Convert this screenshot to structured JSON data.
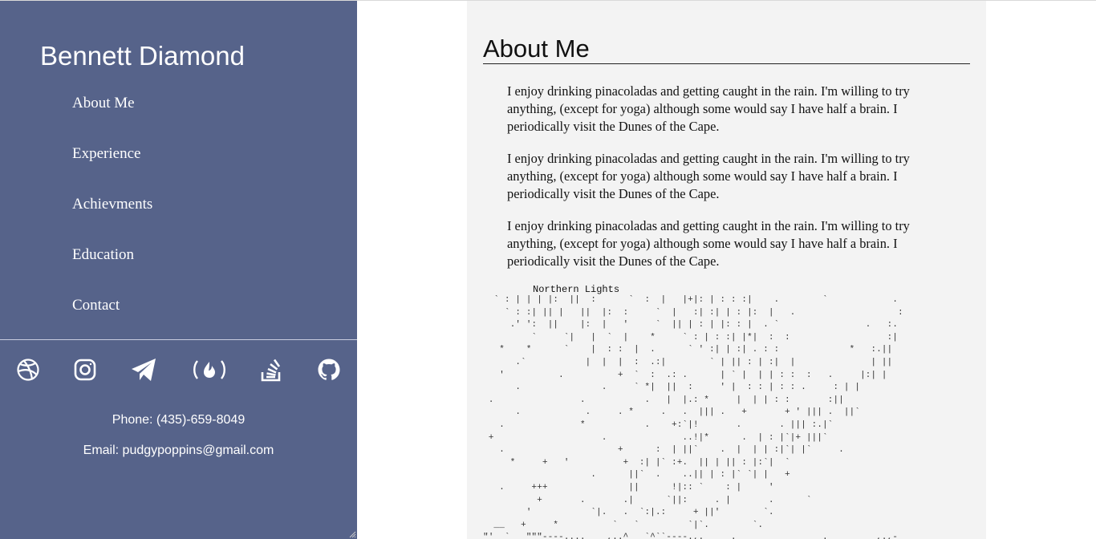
{
  "sidebar": {
    "name": "Bennett Diamond",
    "nav": [
      "About Me",
      "Experience",
      "Achievments",
      "Education",
      "Contact"
    ],
    "social_icons": [
      "dribbble-icon",
      "instagram-icon",
      "telegram-icon",
      "freecodecamp-icon",
      "stackoverflow-icon",
      "github-icon"
    ],
    "phone": "Phone: (435)-659-8049",
    "email": "Email: pudgypoppins@gmail.com"
  },
  "main": {
    "title": "About Me",
    "paragraphs": [
      "I enjoy drinking pinacoladas and getting caught in the rain. I'm willing to try anything, (except for yoga) although some would say I have half a brain. I periodically visit the Dunes of the Cape.",
      "I enjoy drinking pinacoladas and getting caught in the rain. I'm willing to try anything, (except for yoga) although some would say I have half a brain. I periodically visit the Dunes of the Cape.",
      "I enjoy drinking pinacoladas and getting caught in the rain. I'm willing to try anything, (except for yoga) although some would say I have half a brain. I periodically visit the Dunes of the Cape."
    ],
    "ascii_title": "Northern Lights"
  },
  "colors": {
    "sidebar_bg": "#56638a",
    "main_bg": "#f3f3f3",
    "text": "#111111",
    "sidebar_text": "#ffffff"
  }
}
